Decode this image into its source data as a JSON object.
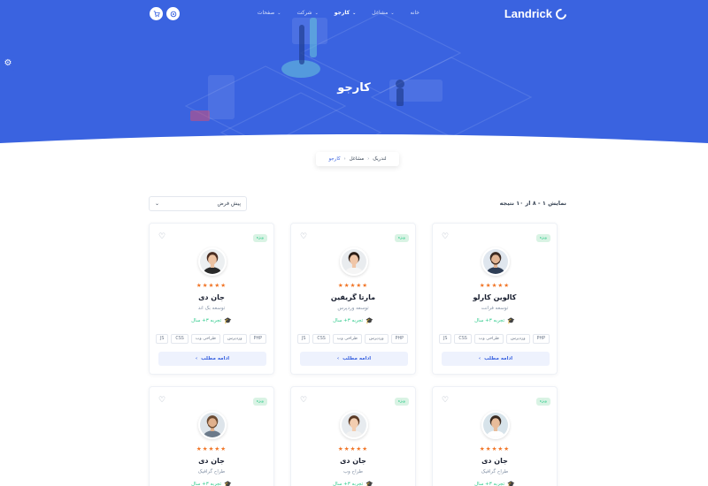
{
  "brand": {
    "name": "Landrick",
    "accent": "#3a63e0"
  },
  "nav": {
    "items": [
      {
        "label": "خانه",
        "dropdown": false,
        "active": false
      },
      {
        "label": "مشاغل",
        "dropdown": true,
        "active": false
      },
      {
        "label": "کارجو",
        "dropdown": true,
        "active": true
      },
      {
        "label": "شرکت",
        "dropdown": true,
        "active": false
      },
      {
        "label": "صفحات",
        "dropdown": true,
        "active": false
      }
    ],
    "icons": [
      "cart-icon",
      "settings-icon"
    ]
  },
  "page": {
    "title": "کارجو"
  },
  "breadcrumb": [
    {
      "label": "لندریک"
    },
    {
      "label": "مشاغل"
    },
    {
      "label": "کارجو",
      "active": true
    }
  ],
  "toolbar": {
    "result_count": "نمایش ۱ - ۸ از ۱۰ نتیجه",
    "sort_value": "پیش فرض"
  },
  "cards": [
    {
      "badge": "ویژه",
      "rating": 5,
      "name": "کالوین کارلو",
      "role": "توسعه فرانت",
      "experience": "تجربه ۳+ سال",
      "tags": [
        "PHP",
        "وردپرس",
        "طراحی وب",
        "CSS",
        "JS"
      ],
      "button": "ادامه مطلب"
    },
    {
      "badge": "ویژه",
      "rating": 5,
      "name": "مارتا گریفین",
      "role": "توسعه وردپرس",
      "experience": "تجربه ۳+ سال",
      "tags": [
        "PHP",
        "وردپرس",
        "طراحی وب",
        "CSS",
        "JS"
      ],
      "button": "ادامه مطلب"
    },
    {
      "badge": "ویژه",
      "rating": 5,
      "name": "جان دی",
      "role": "توسعه بک اند",
      "experience": "تجربه ۳+ سال",
      "tags": [
        "PHP",
        "وردپرس",
        "طراحی وب",
        "CSS",
        "JS"
      ],
      "button": "ادامه مطلب"
    },
    {
      "badge": "ویژه",
      "rating": 5,
      "name": "جان دی",
      "role": "طراح گرافیک",
      "experience": "تجربه ۳+ سال"
    },
    {
      "badge": "ویژه",
      "rating": 5,
      "name": "جان دی",
      "role": "طراح وب",
      "experience": "تجربه ۳+ سال"
    },
    {
      "badge": "ویژه",
      "rating": 5,
      "name": "جان دی",
      "role": "طراح گرافیک",
      "experience": "تجربه ۳+ سال"
    }
  ],
  "colors": {
    "primary": "#3a63e0",
    "success": "#2eca8b",
    "star": "#f17425"
  }
}
